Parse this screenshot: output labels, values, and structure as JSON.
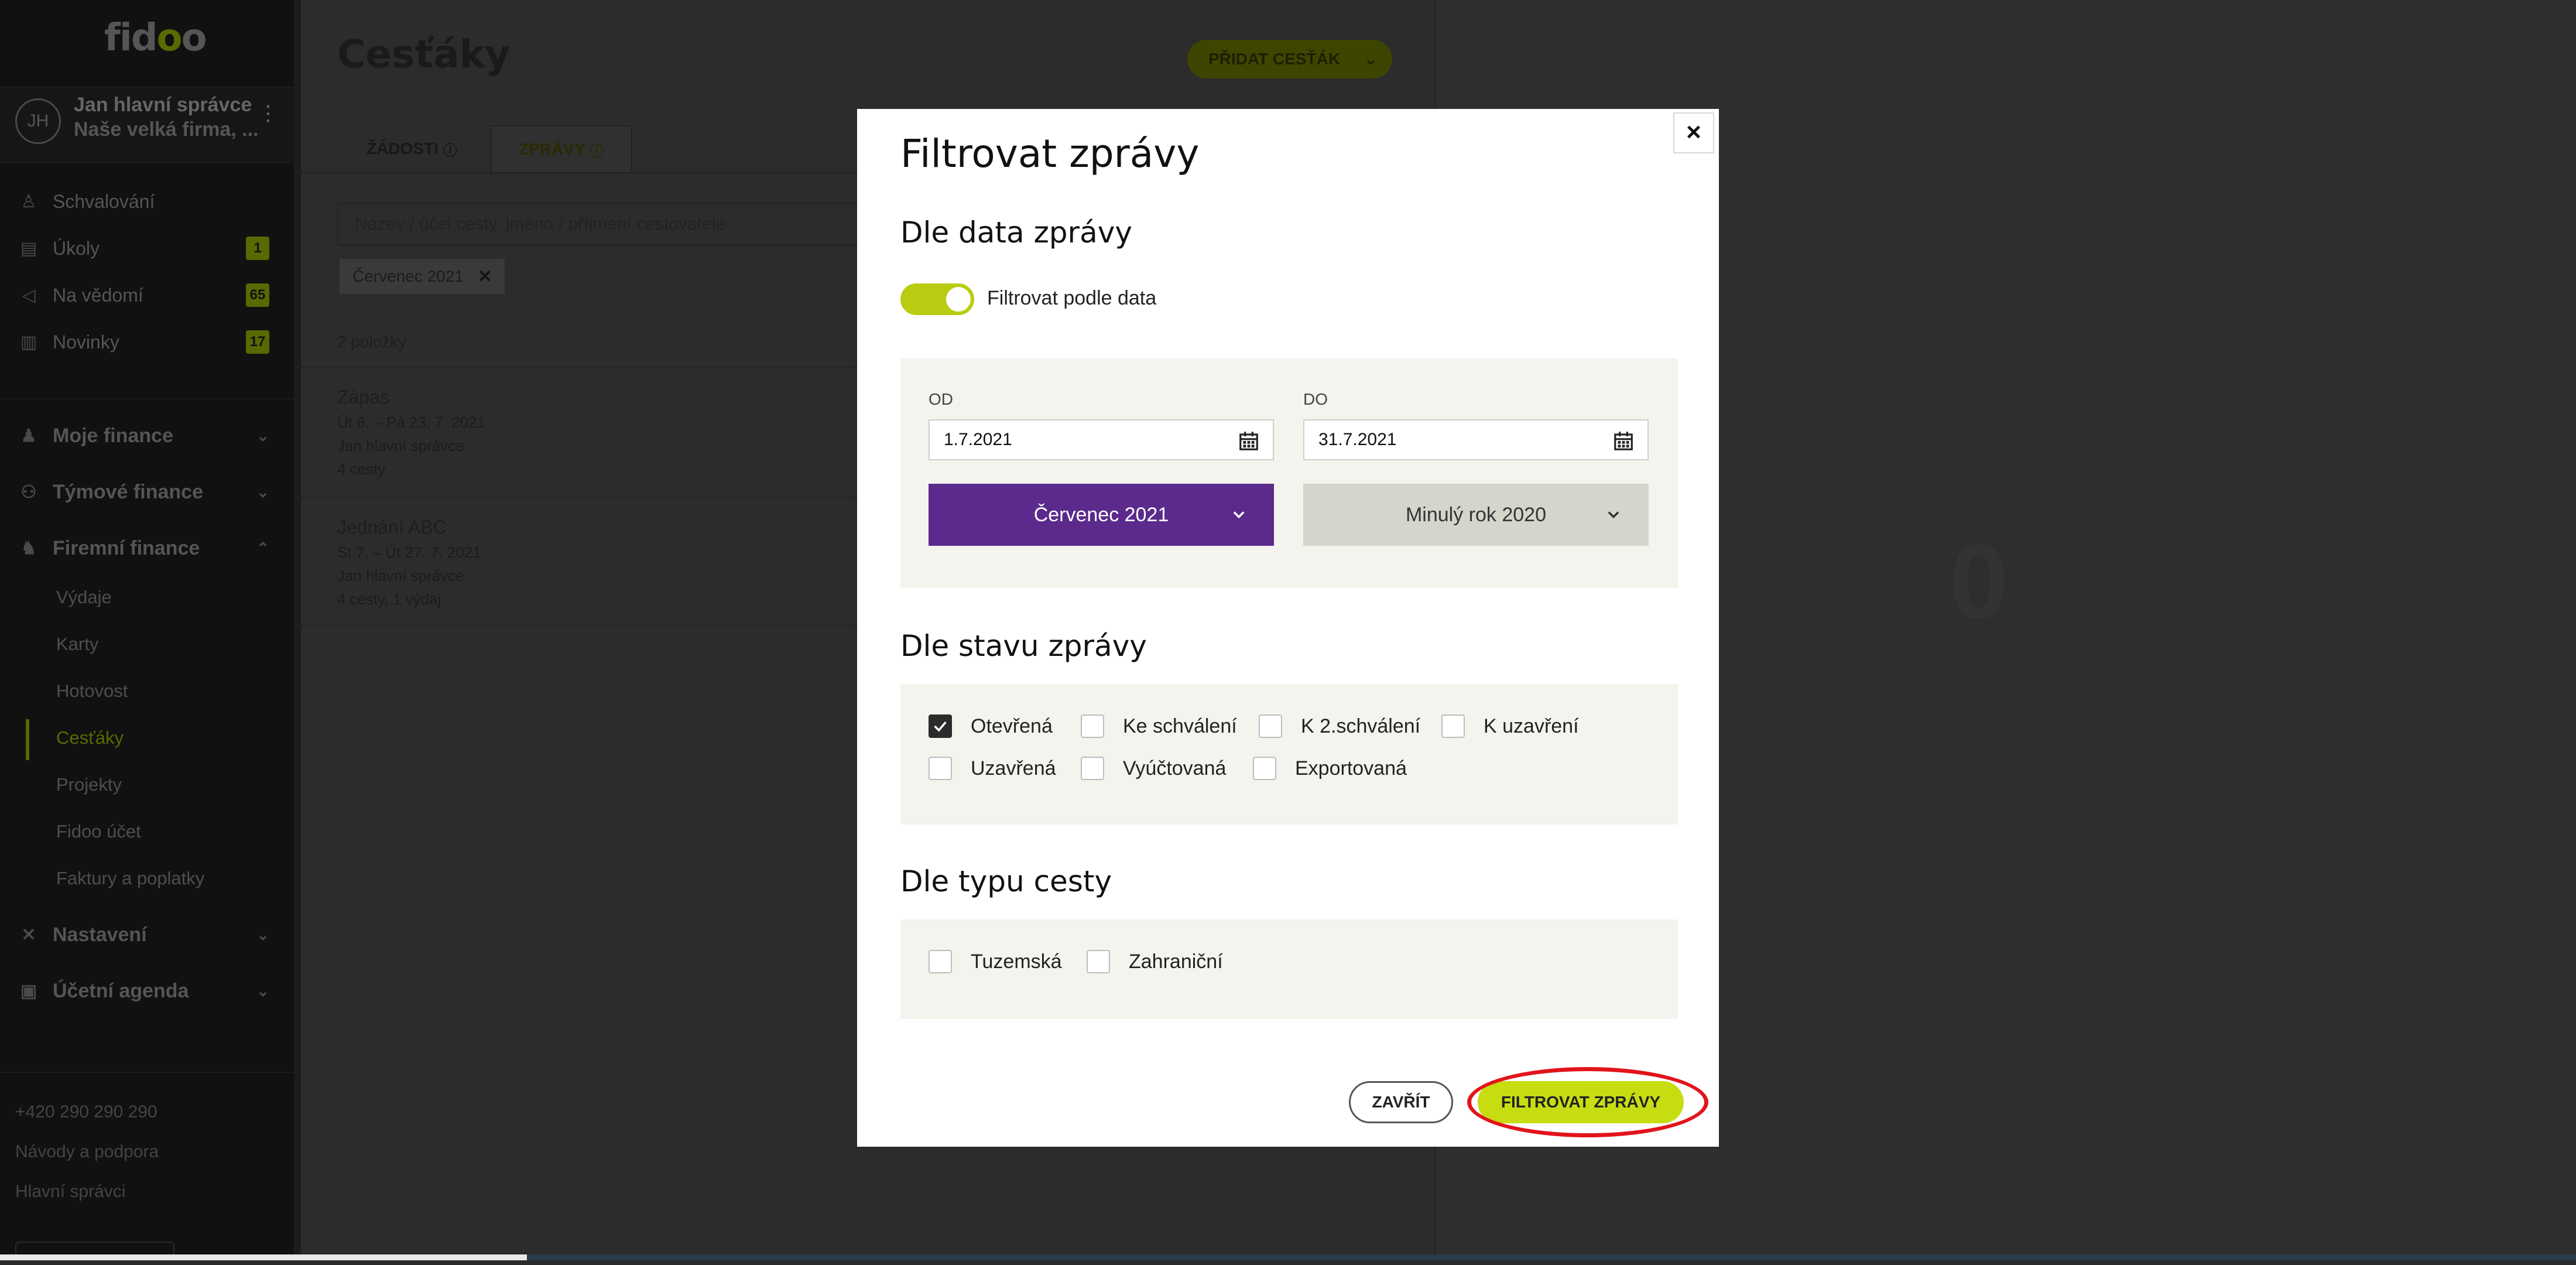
{
  "app": {
    "logo": "fidoo",
    "user": {
      "initials": "JH",
      "name": "Jan hlavní správce",
      "company": "Naše velká firma, ..."
    }
  },
  "sidebar": {
    "items": [
      {
        "label": "Schvalování",
        "icon": "stamp-icon"
      },
      {
        "label": "Úkoly",
        "badge": "1",
        "icon": "clipboard-icon"
      },
      {
        "label": "Na vědomí",
        "badge": "65",
        "icon": "megaphone-icon"
      },
      {
        "label": "Novinky",
        "badge": "17",
        "icon": "book-icon"
      }
    ],
    "groups": [
      {
        "label": "Moje finance",
        "icon": "person-icon"
      },
      {
        "label": "Týmové finance",
        "icon": "team-icon"
      },
      {
        "label": "Firemní finance",
        "icon": "company-icon"
      }
    ],
    "sub_items": [
      "Výdaje",
      "Karty",
      "Hotovost",
      "Cesťáky",
      "Projekty",
      "Fidoo účet",
      "Faktury a poplatky"
    ],
    "groups2": [
      {
        "label": "Nastavení",
        "icon": "tools-icon"
      },
      {
        "label": "Účetní agenda",
        "icon": "accounting-icon"
      }
    ],
    "footer": [
      "+420 290 290 290",
      "Návody a podpora",
      "Hlavní správci"
    ]
  },
  "main": {
    "title": "Cesťáky",
    "add_button": "PŘIDAT CESŤÁK",
    "tabs": [
      "ŽÁDOSTI",
      "ZPRÁVY"
    ],
    "search_placeholder": "Název / účel cesty, jméno / příjmení cestovatele",
    "chip": "Červenec 2021",
    "count": "2 položky",
    "rows": [
      {
        "title": "Zápas",
        "dates": "Út 6. – Pá 23. 7. 2021",
        "person": "Jan hlavní správce",
        "meta": "4 cesty"
      },
      {
        "title": "Jednání ABC",
        "dates": "St 7. – Út 27. 7. 2021",
        "person": "Jan hlavní správce",
        "meta": "4 cesty, 1 výdaj"
      }
    ]
  },
  "modal": {
    "title": "Filtrovat zprávy",
    "section_date": "Dle data zprávy",
    "toggle_label": "Filtrovat podle data",
    "toggle_on": true,
    "from_label": "OD",
    "from_value": "1.7.2021",
    "to_label": "DO",
    "to_value": "31.7.2021",
    "month_select": "Červenec 2021",
    "year_select": "Minulý rok 2020",
    "section_state": "Dle stavu zprávy",
    "states": [
      {
        "label": "Otevřená",
        "checked": true
      },
      {
        "label": "Ke schválení",
        "checked": false
      },
      {
        "label": "K 2.schválení",
        "checked": false
      },
      {
        "label": "K uzavření",
        "checked": false
      },
      {
        "label": "Uzavřená",
        "checked": false
      },
      {
        "label": "Vyúčtovaná",
        "checked": false
      },
      {
        "label": "Exportovaná",
        "checked": false
      }
    ],
    "section_type": "Dle typu cesty",
    "types": [
      {
        "label": "Tuzemská",
        "checked": false
      },
      {
        "label": "Zahraniční",
        "checked": false
      }
    ],
    "close_button": "ZAVŘÍT",
    "filter_button": "FILTROVAT ZPRÁVY"
  },
  "colors": {
    "accent": "#c7dd12",
    "purple": "#5b2a8c",
    "highlight": "#e2141b"
  }
}
